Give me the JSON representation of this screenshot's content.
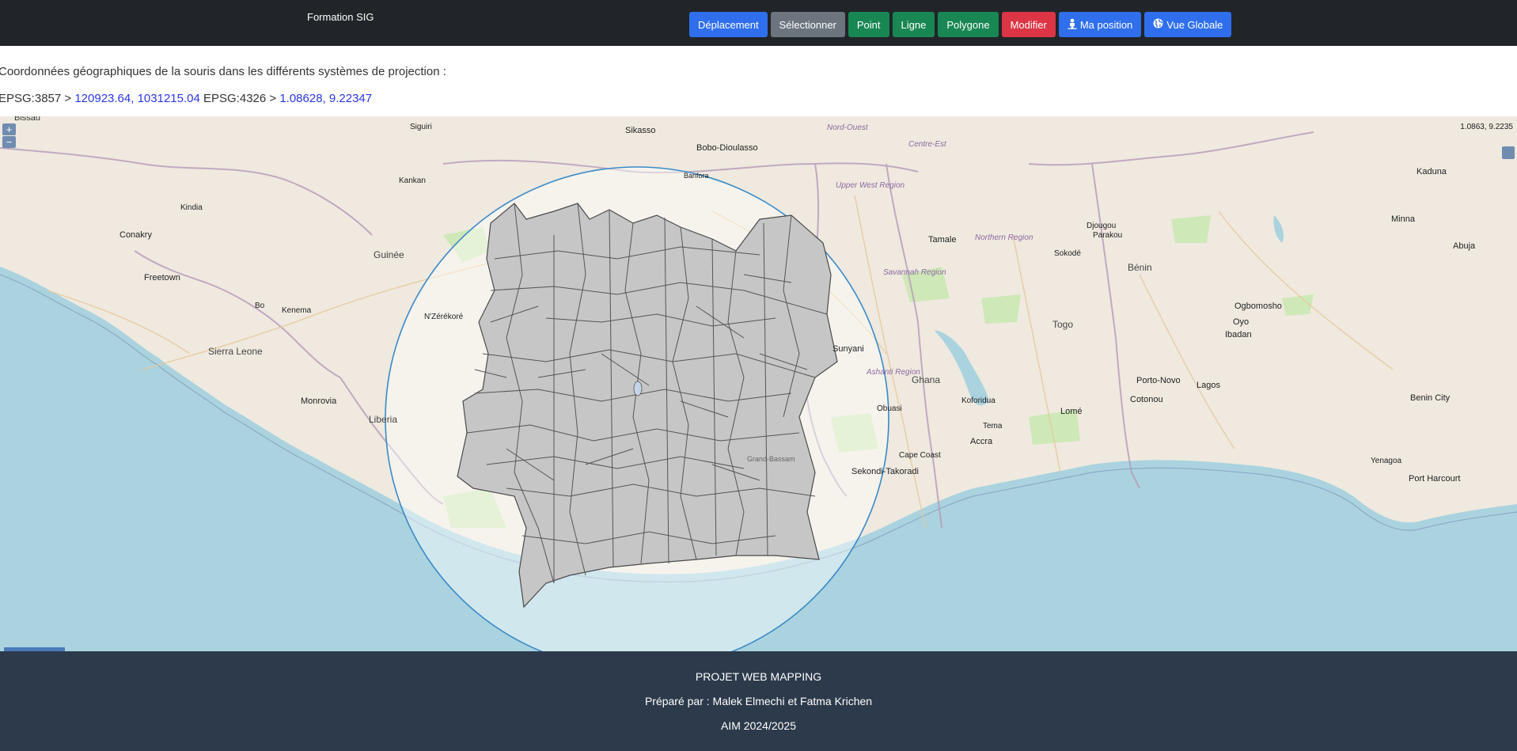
{
  "header": {
    "brand": "Formation SIG",
    "buttons": [
      {
        "label": "Déplacement",
        "color": "#2f6fed"
      },
      {
        "label": "Sélectionner",
        "color": "#6c757d"
      },
      {
        "label": "Point",
        "color": "#198754"
      },
      {
        "label": "Ligne",
        "color": "#198754"
      },
      {
        "label": "Polygone",
        "color": "#198754"
      },
      {
        "label": "Modifier",
        "color": "#dc3545"
      },
      {
        "label": "Ma position",
        "color": "#2f6fed",
        "icon": "person-pin-icon"
      },
      {
        "label": "Vue Globale",
        "color": "#2f6fed",
        "icon": "globe-icon"
      }
    ]
  },
  "coords": {
    "intro": "Coordonnées géographiques de la souris dans les différents systèmes de projection :",
    "epsg3857_label": "EPSG:3857 > ",
    "epsg3857_value": "120923.64, 1031215.04",
    "epsg4326_label": " EPSG:4326 > ",
    "epsg4326_value": "1.08628, 9.22347"
  },
  "map": {
    "zoom_in": "+",
    "zoom_out": "−",
    "mouse_position": "1.0863, 9.2235",
    "labels": {
      "guinee": "Guinée",
      "sierra_leone": "Sierra Leone",
      "liberia": "Liberia",
      "ghana": "Ghana",
      "togo": "Togo",
      "benin": "Bénin",
      "freetown": "Freetown",
      "conakry": "Conakry",
      "monrovia": "Monrovia",
      "accra": "Accra",
      "lome": "Lomé",
      "cotonou": "Cotonou",
      "porto_novo": "Porto-Novo",
      "lagos": "Lagos",
      "ibadan": "Ibadan",
      "abuja": "Abuja",
      "kaduna": "Kaduna",
      "sikasso": "Sikasso",
      "bobo": "Bobo-Dioulasso",
      "tamale": "Tamale",
      "kumasi_region": "Ashanti Region",
      "sekondi": "Sekondi-Takoradi",
      "cape_coast": "Cape Coast",
      "bissau": "Bissau",
      "benin_city": "Benin City",
      "port_harcourt": "Port Harcourt",
      "siguiri": "Siguiri",
      "kankan": "Kankan",
      "nzerekore": "N'Zérékoré",
      "kenema": "Kenema",
      "bo": "Bo",
      "kindia": "Kindia",
      "parakou": "Parakou",
      "djougou": "Djougou",
      "sokode": "Sokodé",
      "ogbomosho": "Ogbomosho",
      "oyo": "Oyo",
      "minna": "Minna",
      "yenagoa": "Yenagoa",
      "kofordua": "Koforidua",
      "tema": "Tema",
      "obuasi": "Obuasi",
      "sunyani": "Sunyani",
      "upper_west": "Upper West Region",
      "northern": "Northern Region",
      "savannah": "Savannah Region",
      "grand_bassam": "Grand-Bassam",
      "banfora": "Banfora",
      "nord_ouest": "Nord-Ouest",
      "centre_est": "Centre-Est"
    }
  },
  "footer": {
    "title": "PROJET WEB MAPPING",
    "authors": "Préparé par : Malek Elmechi et Fatma Krichen",
    "year": "AIM 2024/2025"
  }
}
